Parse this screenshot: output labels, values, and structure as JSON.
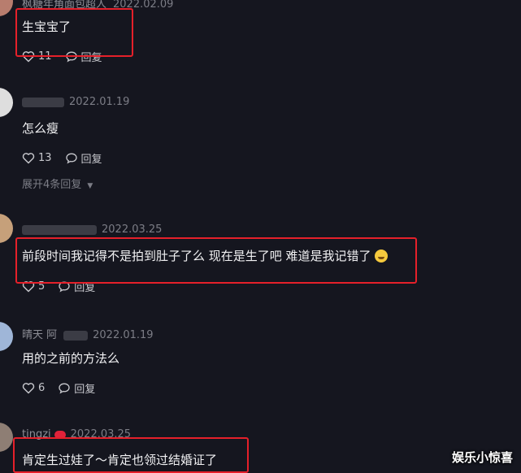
{
  "comments": [
    {
      "name": "枫糖年角面包超人",
      "date": "2022.02.09",
      "text": "生宝宝了",
      "likes": "11",
      "reply_label": "回复"
    },
    {
      "name": "",
      "date": "2022.01.19",
      "text": "怎么瘦",
      "likes": "13",
      "reply_label": "回复",
      "expand_label": "展开4条回复"
    },
    {
      "name": "",
      "date": "2022.03.25",
      "text": "前段时间我记得不是拍到肚子了么 现在是生了吧 难道是我记错了",
      "likes": "5",
      "reply_label": "回复"
    },
    {
      "name": "晴天 阿",
      "date": "2022.01.19",
      "text": "用的之前的方法么",
      "likes": "6",
      "reply_label": "回复"
    },
    {
      "name": "tingzi",
      "date": "2022.03.25",
      "text": "肯定生过娃了～肯定也领过结婚证了"
    }
  ],
  "watermark": "娱乐小惊喜",
  "colors": {
    "background": "#15161f",
    "highlight_box": "#e5202a",
    "meta_text": "#7c7d86"
  }
}
